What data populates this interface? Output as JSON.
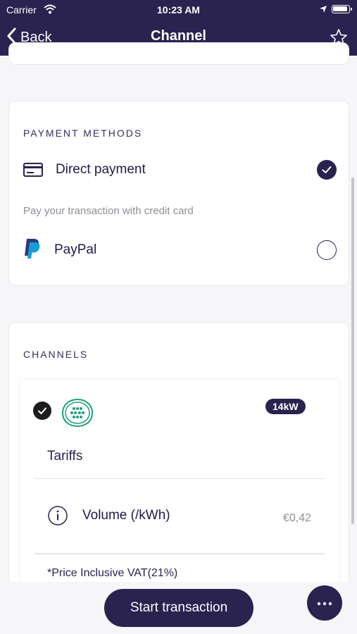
{
  "status_bar": {
    "carrier": "Carrier",
    "time": "10:23 AM"
  },
  "nav": {
    "back_label": "Back",
    "title": "Channel"
  },
  "payment": {
    "section_title": "PAYMENT METHODS",
    "methods": [
      {
        "label": "Direct payment",
        "icon": "credit-card-icon",
        "selected": true
      },
      {
        "label": "PayPal",
        "icon": "paypal-icon",
        "selected": false
      }
    ],
    "hint": "Pay your transaction with credit card"
  },
  "channels": {
    "section_title": "CHANNELS",
    "channel": {
      "selected": true,
      "connector_icon": "ev-connector-icon",
      "power": "14kW",
      "tariffs_label": "Tariffs",
      "tariffs": [
        {
          "name": "Volume (/kWh)",
          "price": "€0,42"
        }
      ],
      "vat_note": "*Price Inclusive VAT(21%)"
    }
  },
  "actions": {
    "start_label": "Start transaction",
    "more_icon": "more-icon"
  },
  "colors": {
    "primary": "#2a224f",
    "connector_green": "#1f9e7a",
    "muted_text": "#8e8e96"
  }
}
